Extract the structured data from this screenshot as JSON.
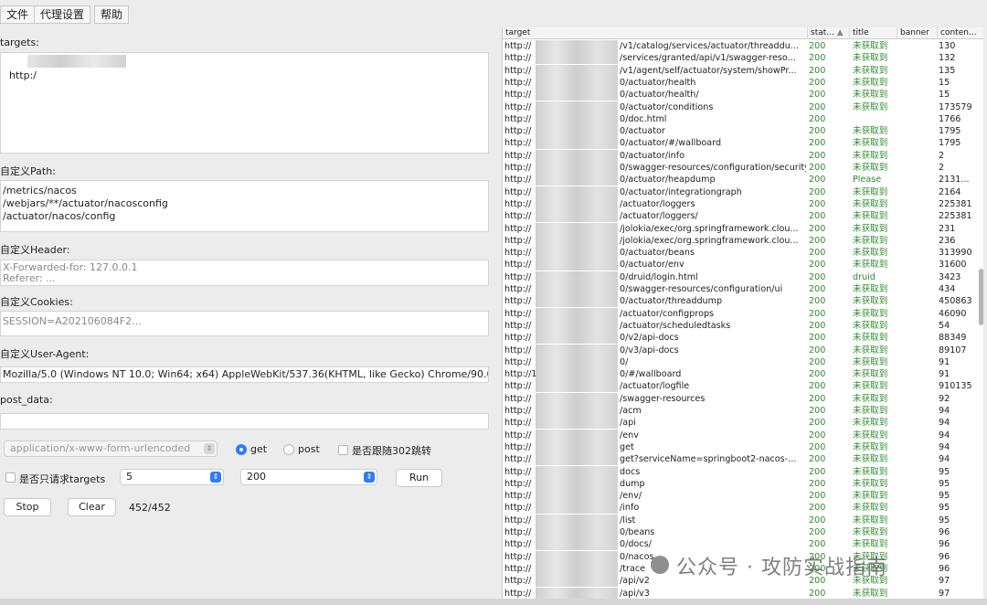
{
  "menu": {
    "file": "文件",
    "proxy": "代理设置",
    "help": "帮助"
  },
  "form": {
    "targets_label": "targets:",
    "targets_value": "http:/",
    "path_label": "自定义Path:",
    "paths": "/metrics/nacos\n/webjars/**/actuator/nacosconfig\n/actuator/nacos/config",
    "header_label": "自定义Header:",
    "header_placeholder": "X-Forwarded-for: 127.0.0.1\nReferer: ...",
    "cookies_label": "自定义Cookies:",
    "cookies_placeholder": "SESSION=A202106084F2...",
    "ua_label": "自定义User-Agent:",
    "ua_value": "Mozilla/5.0 (Windows NT 10.0; Win64; x64) AppleWebKit/537.36(KHTML, like Gecko) Chrome/90.0.44",
    "post_label": "post_data:",
    "content_type": "application/x-www-form-urlencoded",
    "method_get": "get",
    "method_post": "post",
    "follow_redirect": "是否跟随302跳转",
    "only_targets": "是否只请求targets",
    "threads": "5",
    "status_filter": "200",
    "run": "Run",
    "stop": "Stop",
    "clear": "Clear",
    "progress": "452/452"
  },
  "table": {
    "headers": {
      "target": "target",
      "status": "stat...",
      "title": "title",
      "banner": "banner",
      "length": "conten..."
    },
    "rows": [
      {
        "t": "http://",
        "s": "/v1/catalog/services/actuator/threaddu...",
        "st": "200",
        "ti": "未获取到",
        "l": "130"
      },
      {
        "t": "http://",
        "s": "/services/granted/api/v1/swagger-reso...",
        "st": "200",
        "ti": "未获取到",
        "l": "132"
      },
      {
        "t": "http://",
        "s": "/v1/agent/self/actuator/system/showPr...",
        "st": "200",
        "ti": "未获取到",
        "l": "135"
      },
      {
        "t": "http://",
        "s": "0/actuator/health",
        "st": "200",
        "ti": "未获取到",
        "l": "15"
      },
      {
        "t": "http://",
        "s": "0/actuator/health/",
        "st": "200",
        "ti": "未获取到",
        "l": "15"
      },
      {
        "t": "http://",
        "s": "0/actuator/conditions",
        "st": "200",
        "ti": "未获取到",
        "l": "173579"
      },
      {
        "t": "http://",
        "s": "0/doc.html",
        "st": "200",
        "ti": "",
        "l": "1766"
      },
      {
        "t": "http://",
        "s": "0/actuator",
        "st": "200",
        "ti": "未获取到",
        "l": "1795"
      },
      {
        "t": "http://",
        "s": "0/actuator/#/wallboard",
        "st": "200",
        "ti": "未获取到",
        "l": "1795"
      },
      {
        "t": "http://",
        "s": "0/actuator/info",
        "st": "200",
        "ti": "未获取到",
        "l": "2"
      },
      {
        "t": "http://",
        "s": "0/swagger-resources/configuration/security",
        "st": "200",
        "ti": "未获取到",
        "l": "2"
      },
      {
        "t": "http://",
        "s": "0/actuator/heapdump",
        "st": "200",
        "ti": "Please",
        "l": "2131..."
      },
      {
        "t": "http://",
        "s": "0/actuator/integrationgraph",
        "st": "200",
        "ti": "未获取到",
        "l": "2164"
      },
      {
        "t": "http://",
        "s": "/actuator/loggers",
        "st": "200",
        "ti": "未获取到",
        "l": "225381"
      },
      {
        "t": "http://",
        "s": "/actuator/loggers/",
        "st": "200",
        "ti": "未获取到",
        "l": "225381"
      },
      {
        "t": "http://",
        "s": "/jolokia/exec/org.springframework.clou...",
        "st": "200",
        "ti": "未获取到",
        "l": "231"
      },
      {
        "t": "http://",
        "s": "/jolokia/exec/org.springframework.clou...",
        "st": "200",
        "ti": "未获取到",
        "l": "236"
      },
      {
        "t": "http://",
        "s": "0/actuator/beans",
        "st": "200",
        "ti": "未获取到",
        "l": "313990"
      },
      {
        "t": "http://",
        "s": "0/actuator/env",
        "st": "200",
        "ti": "未获取到",
        "l": "31600"
      },
      {
        "t": "http://",
        "s": "0/druid/login.html",
        "st": "200",
        "ti": "druid",
        "l": "3423"
      },
      {
        "t": "http://",
        "s": "0/swagger-resources/configuration/ui",
        "st": "200",
        "ti": "未获取到",
        "l": "434"
      },
      {
        "t": "http://",
        "s": "0/actuator/threaddump",
        "st": "200",
        "ti": "未获取到",
        "l": "450863"
      },
      {
        "t": "http://",
        "s": "/actuator/configprops",
        "st": "200",
        "ti": "未获取到",
        "l": "46090"
      },
      {
        "t": "http://",
        "s": "/actuator/scheduledtasks",
        "st": "200",
        "ti": "未获取到",
        "l": "54"
      },
      {
        "t": "http://",
        "s": "0/v2/api-docs",
        "st": "200",
        "ti": "未获取到",
        "l": "88349"
      },
      {
        "t": "http://",
        "s": "0/v3/api-docs",
        "st": "200",
        "ti": "未获取到",
        "l": "89107"
      },
      {
        "t": "http://",
        "s": "0/",
        "st": "200",
        "ti": "未获取到",
        "l": "91"
      },
      {
        "t": "http://1",
        "s": "0/#/wallboard",
        "st": "200",
        "ti": "未获取到",
        "l": "91"
      },
      {
        "t": "http://",
        "s": "/actuator/logfile",
        "st": "200",
        "ti": "未获取到",
        "l": "910135"
      },
      {
        "t": "http://",
        "s": "/swagger-resources",
        "st": "200",
        "ti": "未获取到",
        "l": "92"
      },
      {
        "t": "http://",
        "s": "/acm",
        "st": "200",
        "ti": "未获取到",
        "l": "94"
      },
      {
        "t": "http://",
        "s": "/api",
        "st": "200",
        "ti": "未获取到",
        "l": "94"
      },
      {
        "t": "http://",
        "s": "/env",
        "st": "200",
        "ti": "未获取到",
        "l": "94"
      },
      {
        "t": "http://",
        "s": "get",
        "st": "200",
        "ti": "未获取到",
        "l": "94"
      },
      {
        "t": "http://",
        "s": "get?serviceName=springboot2-nacos-...",
        "st": "200",
        "ti": "未获取到",
        "l": "94"
      },
      {
        "t": "http://",
        "s": "docs",
        "st": "200",
        "ti": "未获取到",
        "l": "95"
      },
      {
        "t": "http://",
        "s": "dump",
        "st": "200",
        "ti": "未获取到",
        "l": "95"
      },
      {
        "t": "http://",
        "s": "/env/",
        "st": "200",
        "ti": "未获取到",
        "l": "95"
      },
      {
        "t": "http://",
        "s": "/info",
        "st": "200",
        "ti": "未获取到",
        "l": "95"
      },
      {
        "t": "http://",
        "s": "/list",
        "st": "200",
        "ti": "未获取到",
        "l": "95"
      },
      {
        "t": "http://",
        "s": "0/beans",
        "st": "200",
        "ti": "未获取到",
        "l": "96"
      },
      {
        "t": "http://",
        "s": "0/docs/",
        "st": "200",
        "ti": "未获取到",
        "l": "96"
      },
      {
        "t": "http://",
        "s": "0/nacos",
        "st": "200",
        "ti": "未获取到",
        "l": "96"
      },
      {
        "t": "http://",
        "s": "/trace",
        "st": "200",
        "ti": "未获取到",
        "l": "96"
      },
      {
        "t": "http://",
        "s": "/api/v2",
        "st": "200",
        "ti": "未获取到",
        "l": "97"
      },
      {
        "t": "http://",
        "s": "/api/v3",
        "st": "200",
        "ti": "未获取到",
        "l": "97"
      }
    ]
  },
  "watermark": "公众号 · 攻防实战指南"
}
